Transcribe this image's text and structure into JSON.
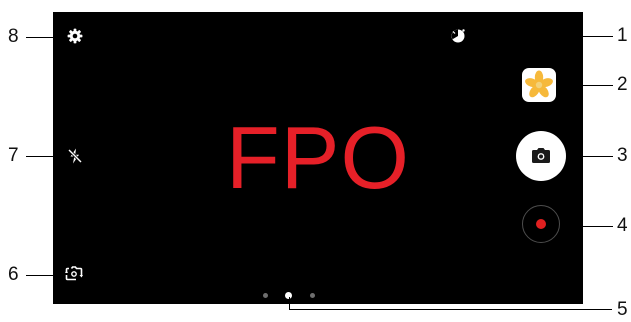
{
  "viewfinder": {
    "placeholder_text": "FPO"
  },
  "controls": {
    "settings_icon": "gear-icon",
    "flash_icon": "flash-off-icon",
    "switch_camera_icon": "switch-camera-icon",
    "effects_icon": "effects-icon",
    "gallery_icon": "gallery-thumbnail-icon",
    "camera_icon": "camera-icon",
    "record_icon": "record-icon"
  },
  "page_indicator": {
    "count": 3,
    "active_index": 1
  },
  "callouts": {
    "one": "1",
    "two": "2",
    "three": "3",
    "four": "4",
    "five": "5",
    "six": "6",
    "seven": "7",
    "eight": "8"
  },
  "colors": {
    "viewfinder_bg": "#000000",
    "placeholder_red": "#e62028",
    "record_red": "#e02020",
    "gallery_star": "#f6b93b"
  }
}
